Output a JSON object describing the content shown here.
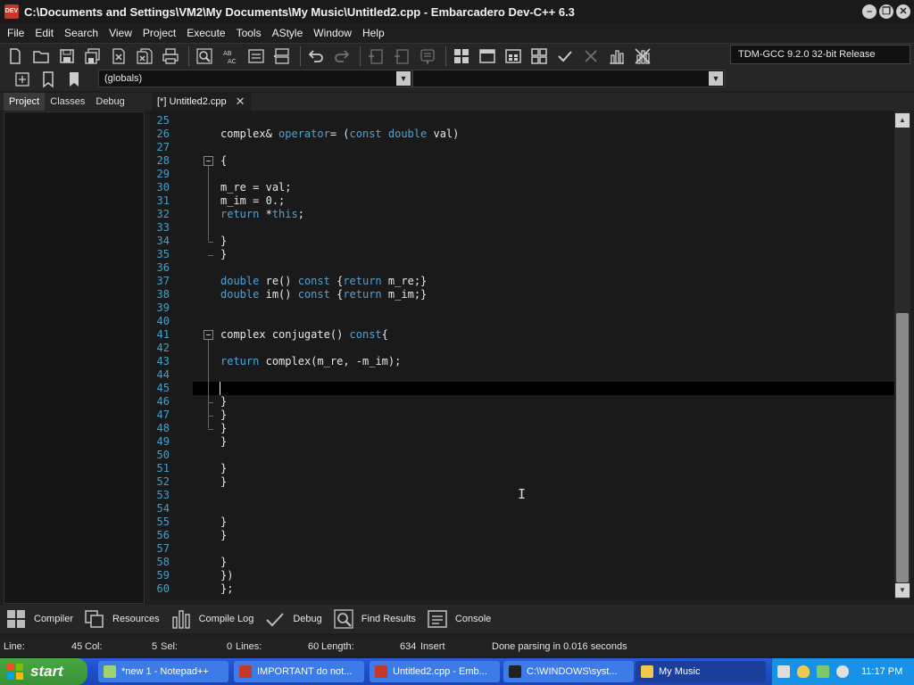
{
  "window": {
    "title": "C:\\Documents and Settings\\VM2\\My Documents\\My Music\\Untitled2.cpp - Embarcadero Dev-C++ 6.3",
    "app_icon_text": "DEV"
  },
  "menu": [
    "File",
    "Edit",
    "Search",
    "View",
    "Project",
    "Execute",
    "Tools",
    "AStyle",
    "Window",
    "Help"
  ],
  "toolbar": {
    "compiler": "TDM-GCC 9.2.0 32-bit Release",
    "scope": "(globals)"
  },
  "left_panel": {
    "tabs": [
      "Project",
      "Classes",
      "Debug"
    ],
    "active_tab": "Project"
  },
  "editor": {
    "tab_label": "[*] Untitled2.cpp",
    "lines": [
      {
        "n": "25",
        "code": ""
      },
      {
        "n": "26",
        "code": "complex& operator= (const double val)"
      },
      {
        "n": "27",
        "code": ""
      },
      {
        "n": "28",
        "code": "{"
      },
      {
        "n": "29",
        "code": ""
      },
      {
        "n": "30",
        "code": "m_re = val;"
      },
      {
        "n": "31",
        "code": "m_im = 0.;"
      },
      {
        "n": "32",
        "code": "return *this;"
      },
      {
        "n": "33",
        "code": ""
      },
      {
        "n": "34",
        "code": "}"
      },
      {
        "n": "35",
        "code": "}"
      },
      {
        "n": "36",
        "code": ""
      },
      {
        "n": "37",
        "code": "double re() const {return m_re;}"
      },
      {
        "n": "38",
        "code": "double im() const {return m_im;}"
      },
      {
        "n": "39",
        "code": ""
      },
      {
        "n": "40",
        "code": ""
      },
      {
        "n": "41",
        "code": "complex conjugate() const{"
      },
      {
        "n": "42",
        "code": ""
      },
      {
        "n": "43",
        "code": "return complex(m_re, -m_im);"
      },
      {
        "n": "44",
        "code": ""
      },
      {
        "n": "45",
        "code": ""
      },
      {
        "n": "46",
        "code": "}"
      },
      {
        "n": "47",
        "code": "}"
      },
      {
        "n": "48",
        "code": "}"
      },
      {
        "n": "49",
        "code": "}"
      },
      {
        "n": "50",
        "code": ""
      },
      {
        "n": "51",
        "code": "}"
      },
      {
        "n": "52",
        "code": "}"
      },
      {
        "n": "53",
        "code": ""
      },
      {
        "n": "54",
        "code": ""
      },
      {
        "n": "55",
        "code": "}"
      },
      {
        "n": "56",
        "code": "}"
      },
      {
        "n": "57",
        "code": ""
      },
      {
        "n": "58",
        "code": "}"
      },
      {
        "n": "59",
        "code": "})"
      },
      {
        "n": "60",
        "code": "};"
      }
    ],
    "current_line": "45",
    "keywords": [
      "operator",
      "const",
      "double",
      "return",
      "this"
    ],
    "colors": {
      "line_number": "#44a0c8",
      "keyword": "#4fa3d8",
      "number": "#e0c341",
      "text": "#e8e8e8"
    }
  },
  "bottom_tabs": [
    "Compiler",
    "Resources",
    "Compile Log",
    "Debug",
    "Find Results",
    "Console"
  ],
  "status": {
    "line_label": "Line:",
    "line_value": "45",
    "col_label": "Col:",
    "col_value": "5",
    "sel_label": "Sel:",
    "sel_value": "0",
    "lines_label": "Lines:",
    "lines_value": "60",
    "length_label": "Length:",
    "length_value": "634",
    "mode": "Insert",
    "message": "Done parsing in 0.016 seconds"
  },
  "taskbar": {
    "start_label": "start",
    "tasks": [
      {
        "label": "*new 1 - Notepad++",
        "icon_color": "#9fd36b",
        "active": false
      },
      {
        "label": "IMPORTANT do not...",
        "icon_color": "#c0392b",
        "active": false
      },
      {
        "label": "Untitled2.cpp - Emb...",
        "icon_color": "#c0392b",
        "active": false
      },
      {
        "label": "C:\\WINDOWS\\syst...",
        "icon_color": "#222222",
        "active": false
      },
      {
        "label": "My Music",
        "icon_color": "#f2c94c",
        "active": true
      }
    ],
    "clock": "11:17 PM"
  }
}
